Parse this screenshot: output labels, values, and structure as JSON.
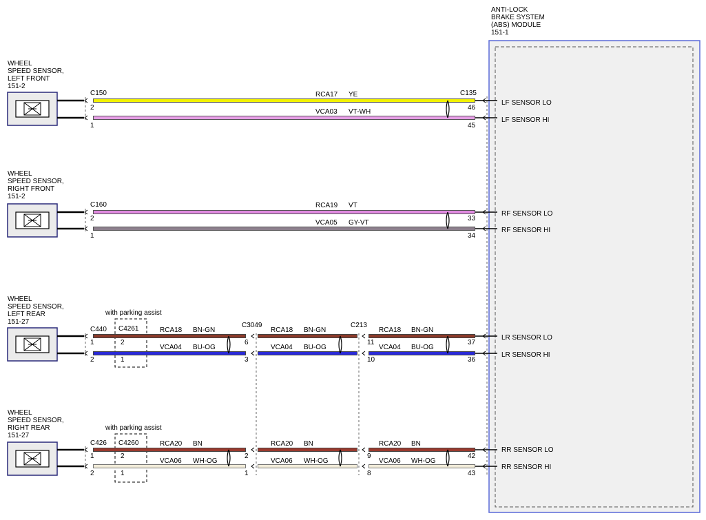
{
  "module": {
    "name_lines": [
      "ANTI-LOCK",
      "BRAKE SYSTEM",
      "(ABS) MODULE",
      "151-1"
    ],
    "pins": [
      {
        "label": "LF SENSOR LO"
      },
      {
        "label": "LF SENSOR HI"
      },
      {
        "label": "RF SENSOR LO"
      },
      {
        "label": "RF SENSOR HI"
      },
      {
        "label": "LR SENSOR LO"
      },
      {
        "label": "LR SENSOR HI"
      },
      {
        "label": "RR SENSOR LO"
      },
      {
        "label": "RR SENSOR HI"
      }
    ]
  },
  "sensors": [
    {
      "label_lines": [
        "WHEEL",
        "SPEED SENSOR,",
        "LEFT FRONT",
        "151-2"
      ]
    },
    {
      "label_lines": [
        "WHEEL",
        "SPEED SENSOR,",
        "RIGHT FRONT",
        "151-2"
      ]
    },
    {
      "label_lines": [
        "WHEEL",
        "SPEED SENSOR,",
        "LEFT REAR",
        "151-27"
      ]
    },
    {
      "label_lines": [
        "WHEEL",
        "SPEED SENSOR,",
        "RIGHT REAR",
        "151-27"
      ]
    }
  ],
  "option_note": "with parking assist",
  "circuits": {
    "lf": {
      "connector_sensor": "C150",
      "connector_module": "C135",
      "wires": [
        {
          "circuit": "RCA17",
          "color_code": "YE",
          "color": "#f2f200",
          "pin_start": "2",
          "pin_end": "46"
        },
        {
          "circuit": "VCA03",
          "color_code": "VT-WH",
          "color": "#e69ee6",
          "pin_start": "1",
          "pin_end": "45"
        }
      ]
    },
    "rf": {
      "connector_sensor": "C160",
      "wires": [
        {
          "circuit": "RCA19",
          "color_code": "VT",
          "color": "#e08ae0",
          "pin_start": "2",
          "pin_end": "33"
        },
        {
          "circuit": "VCA05",
          "color_code": "GY-VT",
          "color": "#8c7f8c",
          "pin_start": "1",
          "pin_end": "34"
        }
      ]
    },
    "lr": {
      "connectors": [
        "C440",
        "C4261",
        "C3049",
        "C213"
      ],
      "wires": [
        {
          "circuit": "RCA18",
          "color_code": "BN-GN",
          "color": "#8b3a2a",
          "pins": [
            "1",
            "2",
            "6",
            "11",
            "37"
          ]
        },
        {
          "circuit": "VCA04",
          "color_code": "BU-OG",
          "color": "#2a2ad8",
          "pins": [
            "2",
            "1",
            "3",
            "10",
            "36"
          ]
        }
      ]
    },
    "rr": {
      "connectors": [
        "C426",
        "C4260"
      ],
      "wires": [
        {
          "circuit": "RCA20",
          "color_code": "BN",
          "color": "#9a3a2e",
          "pins": [
            "1",
            "2",
            "2",
            "9",
            "42"
          ]
        },
        {
          "circuit": "VCA06",
          "color_code": "WH-OG",
          "color": "#f1ebd9",
          "pins": [
            "2",
            "1",
            "1",
            "8",
            "43"
          ]
        }
      ]
    }
  }
}
